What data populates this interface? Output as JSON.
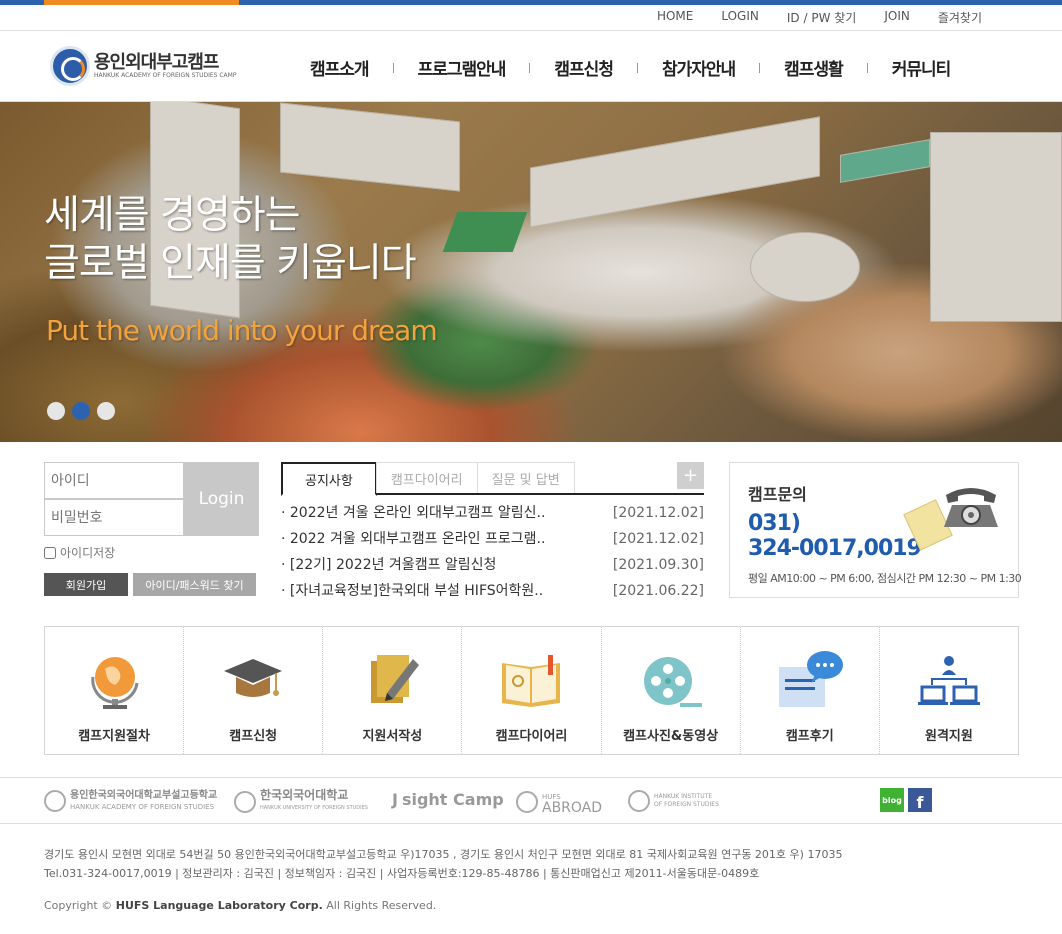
{
  "util_links": [
    "HOME",
    "LOGIN",
    "ID / PW 찾기",
    "JOIN",
    "즐겨찾기"
  ],
  "logo": {
    "name_kr": "용인외대부고캠프",
    "name_en": "HANKUK ACADEMY OF FOREIGN STUDIES CAMP"
  },
  "menu": [
    "캠프소개",
    "프로그램안내",
    "캠프신청",
    "참가자안내",
    "캠프생활",
    "커뮤니티"
  ],
  "hero": {
    "line1": "세계를 경영하는",
    "line2": "글로벌 인재를 키웁니다",
    "slogan": "Put the world into your dream",
    "active_slide": 2,
    "slide_count": 3
  },
  "login": {
    "id_placeholder": "아이디",
    "pw_placeholder": "비밀번호",
    "login_label": "Login",
    "save_id": "아이디저장",
    "join": "회원가입",
    "find": "아이디/패스워드 찾기"
  },
  "board": {
    "tabs": [
      "공지사항",
      "캠프다이어리",
      "질문 및 답변"
    ],
    "more": "+",
    "items": [
      {
        "title": "· 2022년 겨울 온라인 외대부고캠프 알림신..",
        "date": "[2021.12.02]"
      },
      {
        "title": "· 2022 겨울 외대부고캠프 온라인 프로그램..",
        "date": "[2021.12.02]"
      },
      {
        "title": "· [22기] 2022년 겨울캠프 알림신청",
        "date": "[2021.09.30]"
      },
      {
        "title": "· [자녀교육정보]한국외대 부설 HIFS어학원..",
        "date": "[2021.06.22]"
      }
    ]
  },
  "contact": {
    "title": "캠프문의",
    "tel1": "031)",
    "tel2": "324-0017,0019",
    "hours": "평일 AM10:00 ~ PM 6:00,  점심시간 PM 12:30 ~ PM 1:30"
  },
  "quick": [
    {
      "label": "캠프지원절차",
      "icon": "globe-icon"
    },
    {
      "label": "캠프신청",
      "icon": "graduation-cap-icon"
    },
    {
      "label": "지원서작성",
      "icon": "pencil-document-icon"
    },
    {
      "label": "캠프다이어리",
      "icon": "open-book-icon"
    },
    {
      "label": "캠프사진&동영상",
      "icon": "film-reel-icon"
    },
    {
      "label": "캠프후기",
      "icon": "speech-bubble-icon"
    },
    {
      "label": "원격지원",
      "icon": "remote-network-icon"
    }
  ],
  "family_sites": {
    "s1_kr": "용인한국외국어대학교부설고등학교",
    "s1_en": "HANKUK ACADEMY OF FOREIGN STUDIES",
    "s2_kr": "한국외국어대학교",
    "s2_en": "HANKUK UNIVERSITY OF FOREIGN STUDIES",
    "s3": "sight Camp",
    "s4_top": "HUFS",
    "s4": "ABROAD",
    "s5_a": "HANKUK INSTITUTE",
    "s5_b": "OF FOREIGN STUDIES"
  },
  "sns": {
    "blog": "blog",
    "facebook": "f"
  },
  "footer": {
    "addr1": "경기도 용인시 모현면 외대로 54번길 50 용인한국외국어대학교부설고등학교 우)17035 , 경기도 용인시 처인구 모현면 외대로 81 국제사회교육원 연구동 201호 우) 17035",
    "addr2": "Tel.031-324-0017,0019 | 정보관리자 : 김국진 | 정보책임자 : 김국진 | 사업자등록번호:129-85-48786 | 통신판매업신고 제2011-서울동대문-0489호",
    "copy_pre": "Copyright ©",
    "copy_org": "HUFS Language Laboratory Corp.",
    "copy_post": "All Rights Reserved."
  },
  "colors": {
    "brand_blue": "#2b63ad",
    "accent_orange": "#f08a24"
  }
}
